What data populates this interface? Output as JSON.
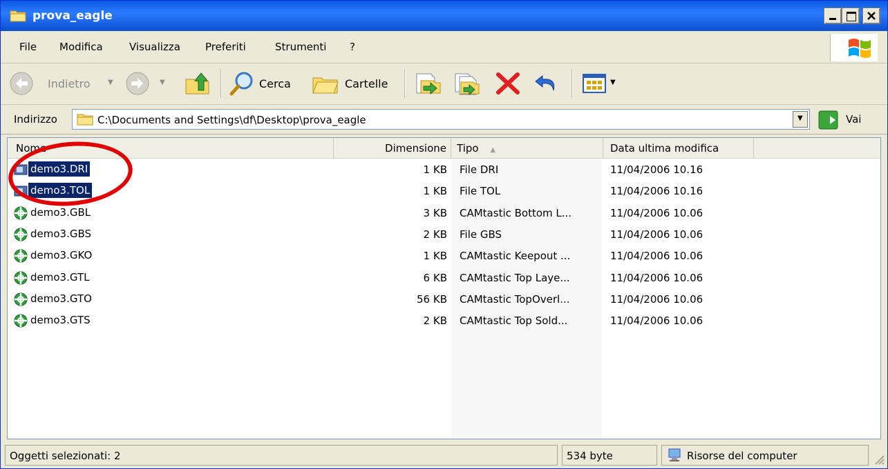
{
  "window": {
    "title": "prova_eagle"
  },
  "menu": [
    "File",
    "Modifica",
    "Visualizza",
    "Preferiti",
    "Strumenti",
    "?"
  ],
  "toolbar": {
    "back_label": "Indietro",
    "search_label": "Cerca",
    "folders_label": "Cartelle"
  },
  "address": {
    "label": "Indirizzo",
    "value": "C:\\Documents and Settings\\df\\Desktop\\prova_eagle",
    "go_label": "Vai"
  },
  "columns": {
    "name": "Nome",
    "size": "Dimensione",
    "type": "Tipo",
    "modified": "Data ultima modifica"
  },
  "files": [
    {
      "name": "demo3.DRI",
      "size": "1 KB",
      "type": "File DRI",
      "modified": "11/04/2006 10.16",
      "selected": true
    },
    {
      "name": "demo3.TOL",
      "size": "1 KB",
      "type": "File TOL",
      "modified": "11/04/2006 10.16",
      "selected": true
    },
    {
      "name": "demo3.GBL",
      "size": "3 KB",
      "type": "CAMtastic Bottom L...",
      "modified": "11/04/2006 10.06",
      "selected": false
    },
    {
      "name": "demo3.GBS",
      "size": "2 KB",
      "type": "File GBS",
      "modified": "11/04/2006 10.06",
      "selected": false
    },
    {
      "name": "demo3.GKO",
      "size": "1 KB",
      "type": "CAMtastic Keepout ...",
      "modified": "11/04/2006 10.06",
      "selected": false
    },
    {
      "name": "demo3.GTL",
      "size": "6 KB",
      "type": "CAMtastic Top Laye...",
      "modified": "11/04/2006 10.06",
      "selected": false
    },
    {
      "name": "demo3.GTO",
      "size": "56 KB",
      "type": "CAMtastic TopOverl...",
      "modified": "11/04/2006 10.06",
      "selected": false
    },
    {
      "name": "demo3.GTS",
      "size": "2 KB",
      "type": "CAMtastic Top Sold...",
      "modified": "11/04/2006 10.06",
      "selected": false
    }
  ],
  "status": {
    "selected_text": "Oggetti selezionati: 2",
    "size_text": "534 byte",
    "location_text": "Risorse del computer"
  },
  "colors": {
    "titlebar": "#0a58e0",
    "selection": "#0a246a",
    "highlight_circle": "#e00000"
  }
}
